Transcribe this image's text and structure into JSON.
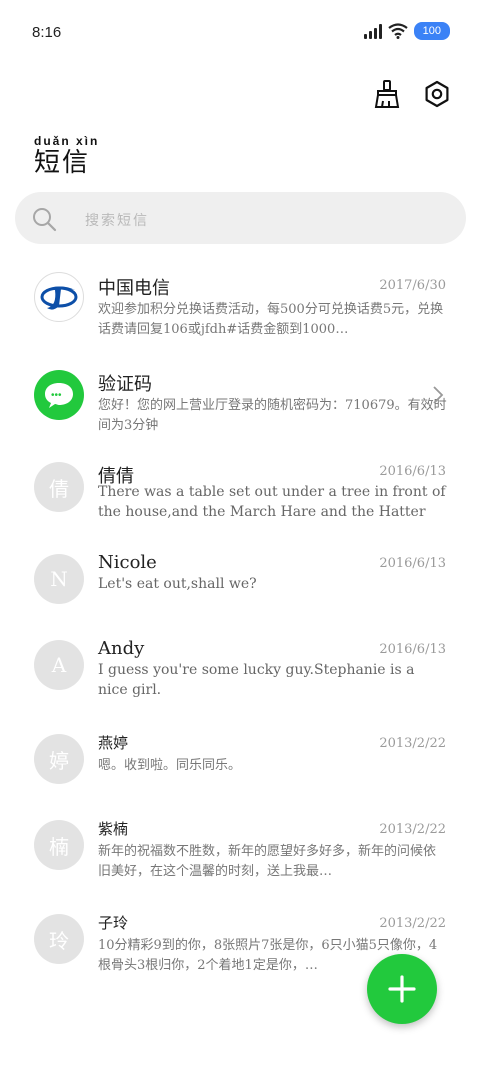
{
  "status_bar": {
    "time": "8:16",
    "battery": "100"
  },
  "toolbar": {
    "clean_icon": "broom-icon",
    "settings_icon": "gear-icon"
  },
  "header": {
    "pinyin": "duǎn xìn",
    "title": "短信"
  },
  "search": {
    "placeholder": "搜索短信"
  },
  "conversations": [
    {
      "name": "中国电信",
      "date": "2017/6/30",
      "preview": "欢迎参加积分兑换话费活动，每500分可兑换话费5元，兑换话费请回复106或jfdh#话费金额到1000…",
      "avatar_type": "telecom-logo"
    },
    {
      "name": "验证码",
      "date": "",
      "preview": "您好！您的网上营业厅登录的随机密码为：710679。有效时间为3分钟",
      "avatar_type": "message-bubble"
    },
    {
      "name": "倩倩",
      "date": "2016/6/13",
      "preview": "There was a table set out under a tree in front of the house,and the March Hare and the Hatter were havi…",
      "avatar_letter": "倩"
    },
    {
      "name": "Nicole",
      "date": "2016/6/13",
      "preview": "Let's eat out,shall we?",
      "avatar_letter": "N"
    },
    {
      "name": "Andy",
      "date": "2016/6/13",
      "preview": "I guess you're some lucky guy.Stephanie is a nice girl.",
      "avatar_letter": "A"
    },
    {
      "name": "燕婷",
      "date": "2013/2/22",
      "preview": "嗯。收到啦。同乐同乐。",
      "avatar_letter": "婷"
    },
    {
      "name": "紫楠",
      "date": "2013/2/22",
      "preview": "新年的祝福数不胜数，新年的愿望好多好多，新年的问候依旧美好，在这个温馨的时刻，送上我最…",
      "avatar_letter": "楠"
    },
    {
      "name": "子玲",
      "date": "2013/2/22",
      "preview": "10分精彩9到的你，8张照片7张是你，6只小猫5只像你，4根骨头3根归你，2个着地1定是你，…",
      "avatar_letter": "玲"
    }
  ],
  "fab": {
    "icon": "plus-icon"
  }
}
